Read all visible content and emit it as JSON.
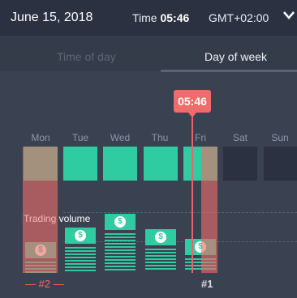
{
  "header": {
    "date": "June 15, 2018",
    "time_label": "Time",
    "time_value": "05:46",
    "timezone": "GMT+02:00"
  },
  "tabs": [
    {
      "label": "Time of day",
      "active": false
    },
    {
      "label": "Day of week",
      "active": true
    }
  ],
  "current_time_badge": "05:46",
  "days": [
    "Mon",
    "Tue",
    "Wed",
    "Thu",
    "Fri",
    "Sat",
    "Sun"
  ],
  "trading_volume": {
    "label_prefix": "Trading",
    "label_suffix": "volume"
  },
  "markers": {
    "left": "#2",
    "right": "#1"
  },
  "colors": {
    "accent_green": "#2fcba1",
    "highlight_red": "#ec6d69",
    "background": "#3a4150"
  }
}
